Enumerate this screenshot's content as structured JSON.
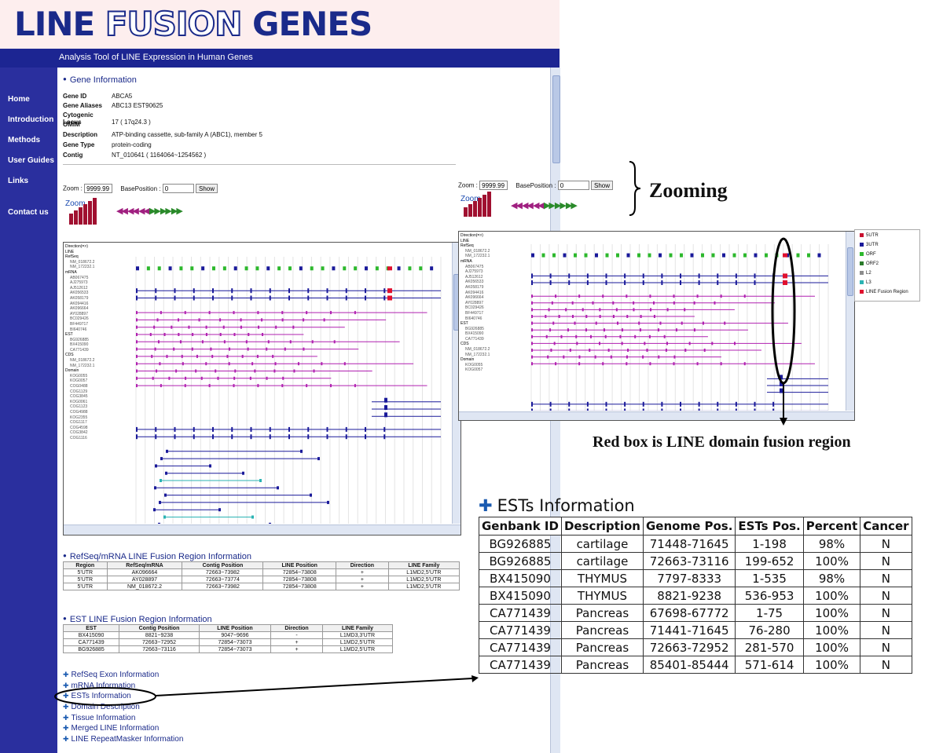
{
  "app": {
    "logo": "LINE FUSION GENES",
    "logo_parts": [
      "LINE ",
      "FUSION",
      " GENES"
    ],
    "subtitle": "Analysis Tool of LINE Expression in Human Genes"
  },
  "nav": {
    "items": [
      "Home",
      "Introduction",
      "Methods",
      "User Guides",
      "Links",
      "Contact us"
    ]
  },
  "gene_info": {
    "heading": "Gene Information",
    "rows": [
      {
        "key": "Gene ID",
        "value": "ABCA5"
      },
      {
        "key": "Gene Aliases",
        "value": "ABC13 EST90625"
      },
      {
        "key": "Cytogenic Locus",
        "value": "17 ( 17q24.3 )"
      },
      {
        "key": "OMIM",
        "value": ""
      },
      {
        "key": "Description",
        "value": "ATP-binding cassette, sub-family A (ABC1), member 5"
      },
      {
        "key": "Gene Type",
        "value": "protein-coding"
      },
      {
        "key": "Contig",
        "value": "NT_010641 ( 1164064~1254562 )"
      }
    ]
  },
  "zoom_controls": {
    "zoom_label": "Zoom :",
    "zoom_value": "9999.99",
    "base_label": "BasePosition :",
    "base_value": "0",
    "show_label": "Show",
    "zoom_icon_label": "Zoom",
    "arrows_left": "◀◀ ◀◀ ◀◀",
    "arrows_right": "▶▶ ▶▶ ▶▶"
  },
  "genome_view": {
    "direction_label": "Direction(=>)",
    "track_labels": [
      "LINE",
      "RefSeq",
      "NM_018672.2",
      "NM_172232.1",
      "mRNA",
      "AB067475",
      "AJ275973",
      "AJ512612",
      "AK056533",
      "AK058179",
      "AK094416",
      "AK096664",
      "AY028897",
      "BC029426",
      "BF449717",
      "BI640746",
      "EST",
      "BG926885",
      "BX415090",
      "CA771439",
      "CDS",
      "NM_018672.2",
      "NM_172232.1",
      "Domain",
      "KOG0055",
      "KOG0057",
      "COG0488",
      "COG1129",
      "COG3845",
      "KOG0061",
      "COG1123",
      "COG4988",
      "KOG2355",
      "COG1117",
      "COG4598",
      "COG3842",
      "COG1116"
    ]
  },
  "zoomed_view": {
    "direction_label": "Direction(=>)",
    "track_labels": [
      "LINE",
      "RefSeq",
      "NM_018672.2",
      "NM_172232.1",
      "mRNA",
      "AB067475",
      "AJ275973",
      "AJ512612",
      "AK056533",
      "AK058179",
      "AK094416",
      "AK096664",
      "AY028897",
      "BC029426",
      "BF449717",
      "BI640746",
      "EST",
      "BG926885",
      "BX415090",
      "CA771439",
      "CDS",
      "NM_018672.2",
      "NM_172232.1",
      "Domain",
      "KOG0055",
      "KOG0057"
    ]
  },
  "legend": {
    "items": [
      {
        "label": "5UTR",
        "color": "#c8102e"
      },
      {
        "label": "3UTR",
        "color": "#1a1a9a"
      },
      {
        "label": "ORF",
        "color": "#2db82d"
      },
      {
        "label": "ORF2",
        "color": "#2a7a2a"
      },
      {
        "label": "L2",
        "color": "#8c8c8c"
      },
      {
        "label": "L3",
        "color": "#2bb3b3"
      },
      {
        "label": "LINE Fusion Region",
        "color": "#e0102e"
      }
    ]
  },
  "annotations": {
    "zooming": "Zooming",
    "red_box": "Red box is LINE domain fusion region"
  },
  "refseq_table": {
    "heading": "RefSeq/mRNA LINE Fusion Region Information",
    "headers": [
      "Region",
      "RefSeq/mRNA",
      "Contig Position",
      "LINE Position",
      "Direction",
      "LINE Family"
    ],
    "rows": [
      [
        "5'UTR",
        "AK096664",
        "72663~73982",
        "72854~73808",
        "+",
        "L1MD2,5'UTR"
      ],
      [
        "5'UTR",
        "AY028897",
        "72663~73774",
        "72854~73808",
        "+",
        "L1MD2,5'UTR"
      ],
      [
        "5'UTR",
        "NM_018672.2",
        "72663~73982",
        "72854~73808",
        "+",
        "L1MD2,5'UTR"
      ]
    ]
  },
  "est_table": {
    "heading": "EST LINE Fusion Region Information",
    "headers": [
      "EST",
      "Contig Position",
      "LINE Position",
      "Direction",
      "LINE Family"
    ],
    "rows": [
      [
        "BX415090",
        "8821~9238",
        "9047~9696",
        "-",
        "L1MD3,3'UTR"
      ],
      [
        "CA771439",
        "72663~72952",
        "72854~73073",
        "+",
        "L1MD2,5'UTR"
      ],
      [
        "BG926885",
        "72663~73116",
        "72854~73073",
        "+",
        "L1MD2,5'UTR"
      ]
    ]
  },
  "links": [
    "RefSeq Exon Information",
    "mRNA Information",
    "ESTs Information",
    "Domain Description",
    "Tissue Information",
    "Merged LINE Information",
    "LINE RepeatMasker Information"
  ],
  "ests_info": {
    "heading": "ESTs Information",
    "headers": [
      "Genbank ID",
      "Description",
      "Genome Pos.",
      "ESTs Pos.",
      "Percent",
      "Cancer"
    ],
    "rows": [
      [
        "BG926885",
        "cartilage",
        "71448-71645",
        "1-198",
        "98%",
        "N"
      ],
      [
        "BG926885",
        "cartilage",
        "72663-73116",
        "199-652",
        "100%",
        "N"
      ],
      [
        "BX415090",
        "THYMUS",
        "7797-8333",
        "1-535",
        "98%",
        "N"
      ],
      [
        "BX415090",
        "THYMUS",
        "8821-9238",
        "536-953",
        "100%",
        "N"
      ],
      [
        "CA771439",
        "Pancreas",
        "67698-67772",
        "1-75",
        "100%",
        "N"
      ],
      [
        "CA771439",
        "Pancreas",
        "71441-71645",
        "76-280",
        "100%",
        "N"
      ],
      [
        "CA771439",
        "Pancreas",
        "72663-72952",
        "281-570",
        "100%",
        "N"
      ],
      [
        "CA771439",
        "Pancreas",
        "85401-85444",
        "571-614",
        "100%",
        "N"
      ]
    ]
  }
}
